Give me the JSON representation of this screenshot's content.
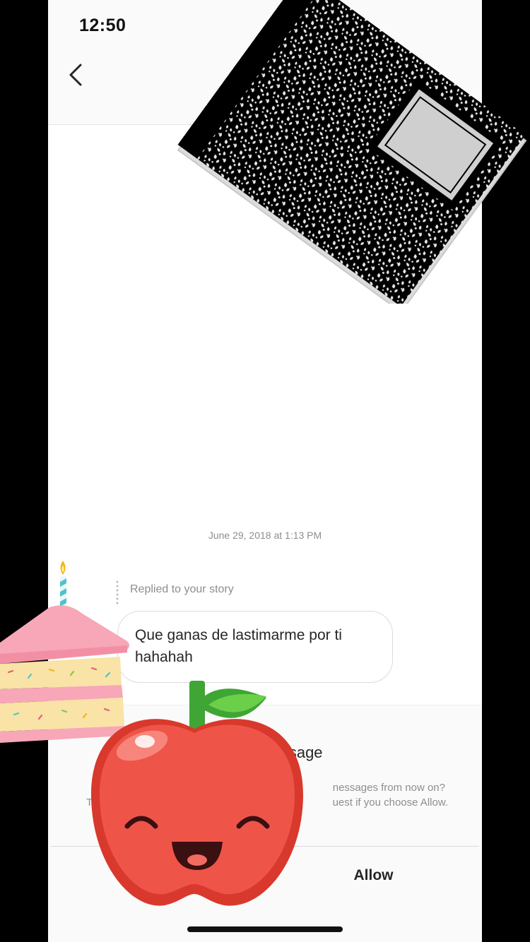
{
  "status_bar": {
    "time": "12:50"
  },
  "nav": {
    "back_icon": "chevron-left-icon"
  },
  "thread": {
    "timestamp": "June 29, 2018 at 1:13 PM",
    "reply_label": "Replied to your story",
    "message_text": "Que ganas de lastimarme por ti hahahah"
  },
  "request": {
    "title_visible": "ou a message",
    "subtitle_line1_visible": "nessages from now on?",
    "subtitle_line2_visible": "uest if you choose Allow.",
    "subtitle_left_fragment": "T",
    "allow_label": "Allow"
  },
  "stickers": {
    "notebook": "composition-notebook-sticker",
    "cake": "birthday-cake-sticker",
    "apple": "smiling-apple-sticker"
  },
  "colors": {
    "allow_text": "#262626",
    "meta_text": "#8e8e8e",
    "panel_bg": "#fafafa",
    "apple_red": "#ef5449"
  }
}
